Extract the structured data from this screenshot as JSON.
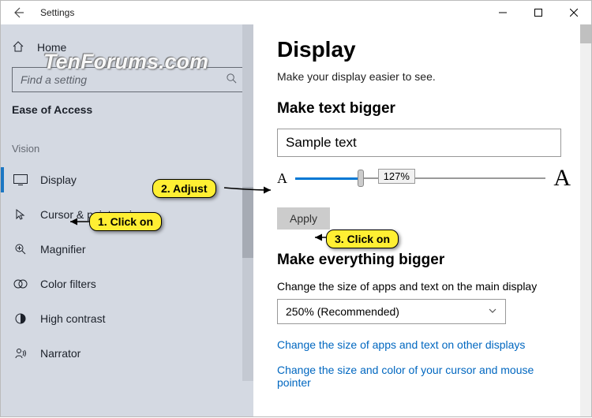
{
  "window": {
    "title": "Settings"
  },
  "sidebar": {
    "home": "Home",
    "search_placeholder": "Find a setting",
    "category": "Ease of Access",
    "group": "Vision",
    "items": [
      {
        "label": "Display",
        "active": true
      },
      {
        "label": "Cursor & pointer size"
      },
      {
        "label": "Magnifier"
      },
      {
        "label": "Color filters"
      },
      {
        "label": "High contrast"
      },
      {
        "label": "Narrator"
      }
    ]
  },
  "main": {
    "title": "Display",
    "subtitle": "Make your display easier to see.",
    "section1": "Make text bigger",
    "sample": "Sample text",
    "slider_value": "127%",
    "apply": "Apply",
    "section2": "Make everything bigger",
    "scale_desc": "Change the size of apps and text on the main display",
    "scale_value": "250% (Recommended)",
    "link1": "Change the size of apps and text on other displays",
    "link2": "Change the size and color of your cursor and mouse pointer"
  },
  "watermark": "TenForums.com",
  "annotations": {
    "c1": "1. Click on",
    "c2": "2. Adjust",
    "c3": "3. Click on"
  }
}
